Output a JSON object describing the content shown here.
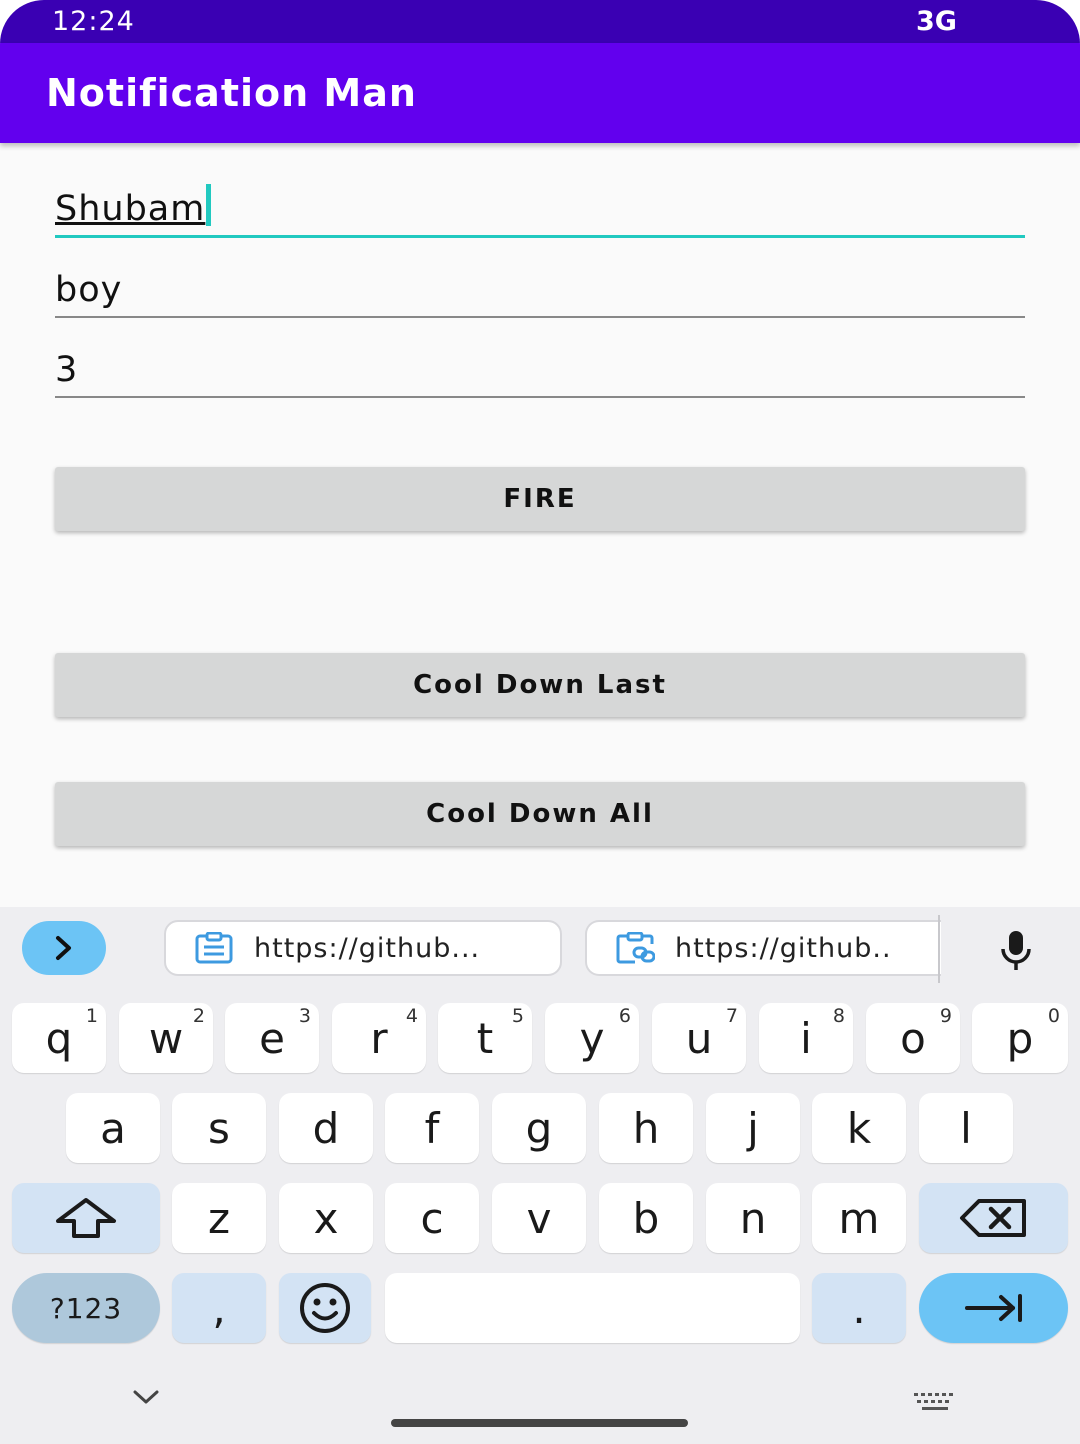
{
  "status_bar": {
    "time": "12:24",
    "network": "3G"
  },
  "app_bar": {
    "title": "Notification Man"
  },
  "form": {
    "title_value": "Shubam",
    "text_value": "boy",
    "count_value": "3"
  },
  "buttons": {
    "fire": "FIRE",
    "cool_down_last": "Cool Down Last",
    "cool_down_all": "Cool Down All"
  },
  "keyboard": {
    "suggestions": [
      "https://github...",
      "https://github.."
    ],
    "row1": [
      {
        "key": "q",
        "hint": "1"
      },
      {
        "key": "w",
        "hint": "2"
      },
      {
        "key": "e",
        "hint": "3"
      },
      {
        "key": "r",
        "hint": "4"
      },
      {
        "key": "t",
        "hint": "5"
      },
      {
        "key": "y",
        "hint": "6"
      },
      {
        "key": "u",
        "hint": "7"
      },
      {
        "key": "i",
        "hint": "8"
      },
      {
        "key": "o",
        "hint": "9"
      },
      {
        "key": "p",
        "hint": "0"
      }
    ],
    "row2": [
      "a",
      "s",
      "d",
      "f",
      "g",
      "h",
      "j",
      "k",
      "l"
    ],
    "row3": [
      "z",
      "x",
      "c",
      "v",
      "b",
      "n",
      "m"
    ],
    "symbols_label": "?123",
    "comma": ",",
    "period": "."
  },
  "colors": {
    "status_bar": "#3a00b3",
    "app_bar": "#6200ee",
    "focus_accent": "#21c9c0",
    "button_bg": "#d6d7d7",
    "keyboard_accent": "#6cc4f5"
  },
  "icons": [
    "chevron-right-icon",
    "clipboard-icon",
    "clipboard-link-icon",
    "microphone-icon",
    "shift-icon",
    "backspace-icon",
    "emoji-icon",
    "tab-enter-icon",
    "chevron-down-icon",
    "keyboard-icon"
  ]
}
